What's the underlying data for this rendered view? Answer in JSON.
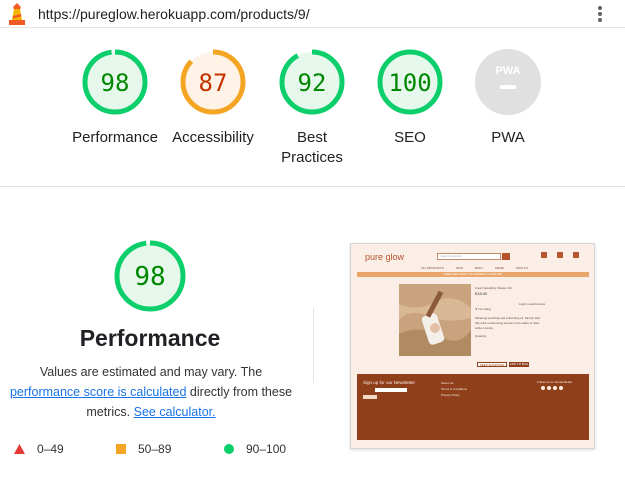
{
  "browser": {
    "url": "https://pureglow.herokuapp.com/products/9/",
    "logo_icon": "lighthouse-icon",
    "menu_icon": "kebab-menu-icon"
  },
  "scores": [
    {
      "label": "Performance",
      "value": "98",
      "numeric": 98,
      "status": "pass"
    },
    {
      "label": "Accessibility",
      "value": "87",
      "numeric": 87,
      "status": "average"
    },
    {
      "label": "Best Practices",
      "value": "92",
      "numeric": 92,
      "status": "pass"
    },
    {
      "label": "SEO",
      "value": "100",
      "numeric": 100,
      "status": "pass"
    },
    {
      "label": "PWA",
      "value": "PWA",
      "numeric": null,
      "status": "na"
    }
  ],
  "performance": {
    "score": "98",
    "score_numeric": 98,
    "title": "Performance",
    "desc_1": "Values are estimated and may vary. The",
    "desc_link_1": "performance score is calculated",
    "desc_2": "directly from these metrics.",
    "desc_link_2": "See calculator."
  },
  "legend": [
    {
      "range": "0–49",
      "shape": "triangle",
      "color": "#e53935"
    },
    {
      "range": "50–89",
      "shape": "square",
      "color": "#f4a523"
    },
    {
      "range": "90–100",
      "shape": "circle",
      "color": "#0cce6b"
    }
  ],
  "colors": {
    "pass": "#0cce6b",
    "pass_text": "#008800",
    "pass_fill": "#e6f8ec",
    "average": "#f4a523",
    "average_text": "#c33300",
    "average_fill": "#fef3e6",
    "na": "#e0e0e0",
    "link": "#1a73e8"
  },
  "thumbnail": {
    "brand": "pure glow",
    "search_placeholder": "Search products",
    "nav": [
      "ALL PRODUCTS",
      "SKIN",
      "BATH",
      "HOME",
      "HOW TO"
    ],
    "banner": "FREE DELIVERY ON ORDERS OVER €50",
    "product_name": "Fresh Sparkling Shower Oil",
    "price": "€18.00",
    "rating": "★ No rating",
    "login_note": "Login to add review",
    "description": "Silkening soothing and refreshing oil. Simply add this ultra moisturising shower oil to water & relax while it works.",
    "quantity_label": "Quantity",
    "keep_shopping": "KEEP SHOPPING",
    "add_to_bag": "ADD TO BAG",
    "newsletter": "Sign up for our Newsletter",
    "footer_links": [
      "About Us",
      "Terms & Conditions",
      "Privacy Policy"
    ],
    "social_label": "Follow us on Social Media"
  }
}
